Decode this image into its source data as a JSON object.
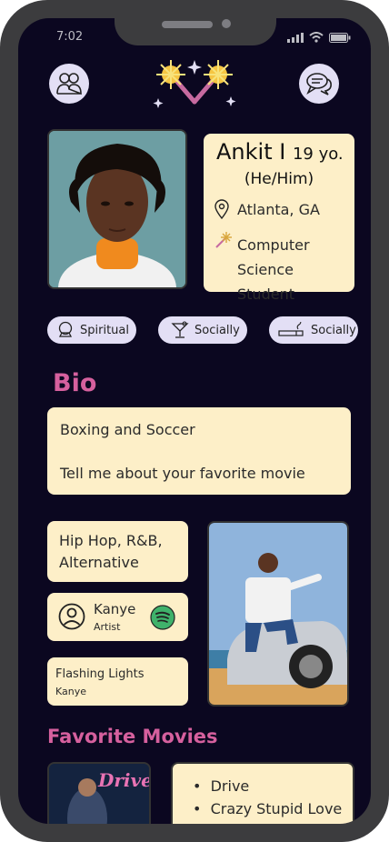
{
  "status": {
    "time": "7:02"
  },
  "profile": {
    "name": "Ankit I",
    "age": "19 yo.",
    "pronouns": "(He/Him)",
    "location": "Atlanta, GA",
    "occupation_line1": "Computer",
    "occupation_line2": "Science Student"
  },
  "chips": [
    {
      "label": "Spiritual",
      "icon": "crystal-ball-icon"
    },
    {
      "label": "Socially",
      "icon": "cocktail-glass-icon"
    },
    {
      "label": "Socially",
      "icon": "cigarette-icon"
    }
  ],
  "bio": {
    "heading": "Bio",
    "line1": "Boxing and Soccer",
    "line2": "Tell me about your favorite movie"
  },
  "music": {
    "genres_line1": "Hip Hop, R&B,",
    "genres_line2": "Alternative",
    "artist_name": "Kanye",
    "artist_role": "Artist",
    "song_title": "Flashing Lights",
    "song_artist": "Kanye"
  },
  "movies": {
    "heading": "Favorite Movies",
    "poster_title": "Drive",
    "list": [
      "Drive",
      "Crazy Stupid Love"
    ]
  },
  "colors": {
    "background": "#0b0720",
    "card": "#fdefc8",
    "accent": "#d6609e",
    "chip": "#e3dff5"
  }
}
